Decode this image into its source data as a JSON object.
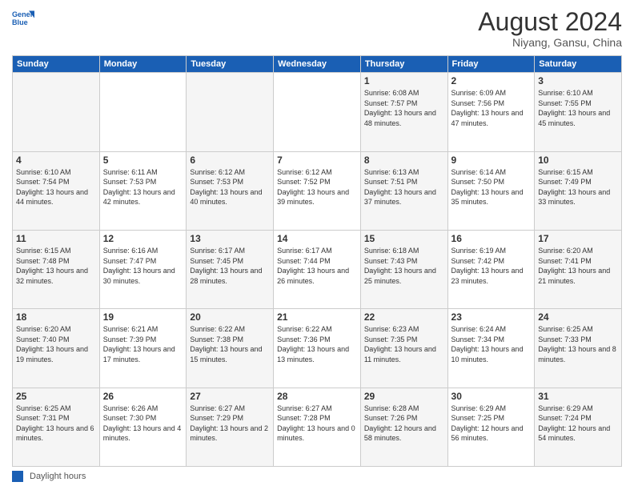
{
  "logo": {
    "line1": "General",
    "line2": "Blue"
  },
  "title": "August 2024",
  "subtitle": "Niyang, Gansu, China",
  "days_of_week": [
    "Sunday",
    "Monday",
    "Tuesday",
    "Wednesday",
    "Thursday",
    "Friday",
    "Saturday"
  ],
  "weeks": [
    [
      {
        "num": "",
        "info": ""
      },
      {
        "num": "",
        "info": ""
      },
      {
        "num": "",
        "info": ""
      },
      {
        "num": "",
        "info": ""
      },
      {
        "num": "1",
        "info": "Sunrise: 6:08 AM\nSunset: 7:57 PM\nDaylight: 13 hours and 48 minutes."
      },
      {
        "num": "2",
        "info": "Sunrise: 6:09 AM\nSunset: 7:56 PM\nDaylight: 13 hours and 47 minutes."
      },
      {
        "num": "3",
        "info": "Sunrise: 6:10 AM\nSunset: 7:55 PM\nDaylight: 13 hours and 45 minutes."
      }
    ],
    [
      {
        "num": "4",
        "info": "Sunrise: 6:10 AM\nSunset: 7:54 PM\nDaylight: 13 hours and 44 minutes."
      },
      {
        "num": "5",
        "info": "Sunrise: 6:11 AM\nSunset: 7:53 PM\nDaylight: 13 hours and 42 minutes."
      },
      {
        "num": "6",
        "info": "Sunrise: 6:12 AM\nSunset: 7:53 PM\nDaylight: 13 hours and 40 minutes."
      },
      {
        "num": "7",
        "info": "Sunrise: 6:12 AM\nSunset: 7:52 PM\nDaylight: 13 hours and 39 minutes."
      },
      {
        "num": "8",
        "info": "Sunrise: 6:13 AM\nSunset: 7:51 PM\nDaylight: 13 hours and 37 minutes."
      },
      {
        "num": "9",
        "info": "Sunrise: 6:14 AM\nSunset: 7:50 PM\nDaylight: 13 hours and 35 minutes."
      },
      {
        "num": "10",
        "info": "Sunrise: 6:15 AM\nSunset: 7:49 PM\nDaylight: 13 hours and 33 minutes."
      }
    ],
    [
      {
        "num": "11",
        "info": "Sunrise: 6:15 AM\nSunset: 7:48 PM\nDaylight: 13 hours and 32 minutes."
      },
      {
        "num": "12",
        "info": "Sunrise: 6:16 AM\nSunset: 7:47 PM\nDaylight: 13 hours and 30 minutes."
      },
      {
        "num": "13",
        "info": "Sunrise: 6:17 AM\nSunset: 7:45 PM\nDaylight: 13 hours and 28 minutes."
      },
      {
        "num": "14",
        "info": "Sunrise: 6:17 AM\nSunset: 7:44 PM\nDaylight: 13 hours and 26 minutes."
      },
      {
        "num": "15",
        "info": "Sunrise: 6:18 AM\nSunset: 7:43 PM\nDaylight: 13 hours and 25 minutes."
      },
      {
        "num": "16",
        "info": "Sunrise: 6:19 AM\nSunset: 7:42 PM\nDaylight: 13 hours and 23 minutes."
      },
      {
        "num": "17",
        "info": "Sunrise: 6:20 AM\nSunset: 7:41 PM\nDaylight: 13 hours and 21 minutes."
      }
    ],
    [
      {
        "num": "18",
        "info": "Sunrise: 6:20 AM\nSunset: 7:40 PM\nDaylight: 13 hours and 19 minutes."
      },
      {
        "num": "19",
        "info": "Sunrise: 6:21 AM\nSunset: 7:39 PM\nDaylight: 13 hours and 17 minutes."
      },
      {
        "num": "20",
        "info": "Sunrise: 6:22 AM\nSunset: 7:38 PM\nDaylight: 13 hours and 15 minutes."
      },
      {
        "num": "21",
        "info": "Sunrise: 6:22 AM\nSunset: 7:36 PM\nDaylight: 13 hours and 13 minutes."
      },
      {
        "num": "22",
        "info": "Sunrise: 6:23 AM\nSunset: 7:35 PM\nDaylight: 13 hours and 11 minutes."
      },
      {
        "num": "23",
        "info": "Sunrise: 6:24 AM\nSunset: 7:34 PM\nDaylight: 13 hours and 10 minutes."
      },
      {
        "num": "24",
        "info": "Sunrise: 6:25 AM\nSunset: 7:33 PM\nDaylight: 13 hours and 8 minutes."
      }
    ],
    [
      {
        "num": "25",
        "info": "Sunrise: 6:25 AM\nSunset: 7:31 PM\nDaylight: 13 hours and 6 minutes."
      },
      {
        "num": "26",
        "info": "Sunrise: 6:26 AM\nSunset: 7:30 PM\nDaylight: 13 hours and 4 minutes."
      },
      {
        "num": "27",
        "info": "Sunrise: 6:27 AM\nSunset: 7:29 PM\nDaylight: 13 hours and 2 minutes."
      },
      {
        "num": "28",
        "info": "Sunrise: 6:27 AM\nSunset: 7:28 PM\nDaylight: 13 hours and 0 minutes."
      },
      {
        "num": "29",
        "info": "Sunrise: 6:28 AM\nSunset: 7:26 PM\nDaylight: 12 hours and 58 minutes."
      },
      {
        "num": "30",
        "info": "Sunrise: 6:29 AM\nSunset: 7:25 PM\nDaylight: 12 hours and 56 minutes."
      },
      {
        "num": "31",
        "info": "Sunrise: 6:29 AM\nSunset: 7:24 PM\nDaylight: 12 hours and 54 minutes."
      }
    ]
  ],
  "footer": {
    "legend_label": "Daylight hours"
  }
}
